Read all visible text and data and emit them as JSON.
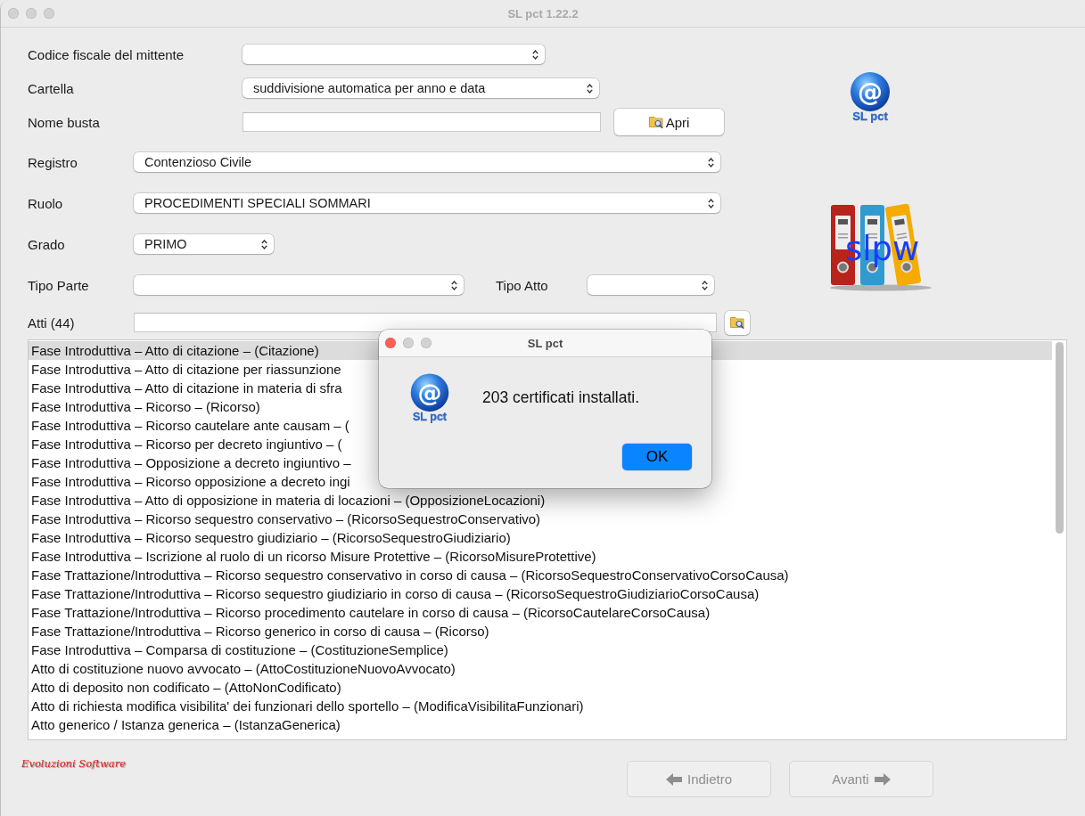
{
  "window": {
    "title": "SL pct 1.22.2",
    "focused": false
  },
  "envelope_fields": [
    {
      "kind": "select",
      "label": "Codice fiscale del mittente"
    },
    {
      "kind": "select",
      "label": "Cartella",
      "value": "suddivisione automatica per anno e data"
    },
    {
      "kind": "text",
      "label": "Nome busta",
      "button": "Apri"
    }
  ],
  "case_fields": [
    {
      "kind": "select",
      "label": "Registro",
      "value": "Contenzioso Civile"
    },
    {
      "kind": "select",
      "label": "Ruolo",
      "value": "PROCEDIMENTI SPECIALI SOMMARI"
    },
    {
      "kind": "select",
      "label": "Grado",
      "value": "PRIMO"
    },
    {
      "kind": "pair",
      "label": "Tipo Parte",
      "second_label": "Tipo Atto"
    },
    {
      "kind": "search",
      "label": "Atti (44)"
    }
  ],
  "logo": {
    "symbol": "@",
    "caption": "SL pct"
  },
  "binders_logo": {
    "text": "slpw"
  },
  "acts_list": {
    "rows": [
      {
        "text": "Fase Introduttiva – Atto di citazione – (Citazione)",
        "selected": true
      },
      {
        "text": "Fase Introduttiva – Atto di citazione per riassunzione",
        "selected": false
      },
      {
        "text": "Fase Introduttiva – Atto di citazione in materia di sfra",
        "selected": false
      },
      {
        "text": "Fase Introduttiva – Ricorso – (Ricorso)",
        "selected": false
      },
      {
        "text": "Fase Introduttiva – Ricorso cautelare ante causam – (",
        "selected": false
      },
      {
        "text": "Fase Introduttiva – Ricorso per decreto ingiuntivo – (",
        "selected": false
      },
      {
        "text": "Fase Introduttiva – Opposizione a decreto ingiuntivo –",
        "selected": false
      },
      {
        "text": "Fase Introduttiva – Ricorso opposizione a decreto ingi",
        "selected": false
      },
      {
        "text": "Fase Introduttiva – Atto di opposizione in materia di locazioni – (OpposizioneLocazioni)",
        "selected": false
      },
      {
        "text": "Fase Introduttiva – Ricorso sequestro conservativo – (RicorsoSequestroConservativo)",
        "selected": false
      },
      {
        "text": "Fase Introduttiva – Ricorso sequestro giudiziario – (RicorsoSequestroGiudiziario)",
        "selected": false
      },
      {
        "text": "Fase Introduttiva – Iscrizione al ruolo di un ricorso Misure Protettive – (RicorsoMisureProtettive)",
        "selected": false
      },
      {
        "text": "Fase Trattazione/Introduttiva – Ricorso sequestro conservativo in corso di causa – (RicorsoSequestroConservativoCorsoCausa)",
        "selected": false
      },
      {
        "text": "Fase Trattazione/Introduttiva – Ricorso sequestro giudiziario in corso di causa – (RicorsoSequestroGiudiziarioCorsoCausa)",
        "selected": false
      },
      {
        "text": "Fase Trattazione/Introduttiva – Ricorso procedimento cautelare in corso di causa – (RicorsoCautelareCorsoCausa)",
        "selected": false
      },
      {
        "text": "Fase Trattazione/Introduttiva – Ricorso generico in corso di causa – (Ricorso)",
        "selected": false
      },
      {
        "text": "Fase Introduttiva – Comparsa di costituzione – (CostituzioneSemplice)",
        "selected": false
      },
      {
        "text": "Atto di costituzione nuovo avvocato – (AttoCostituzioneNuovoAvvocato)",
        "selected": false
      },
      {
        "text": "Atto di deposito non codificato – (AttoNonCodificato)",
        "selected": false
      },
      {
        "text": "Atto di richiesta modifica visibilita' dei funzionari dello sportello – (ModificaVisibilitaFunzionari)",
        "selected": false
      },
      {
        "text": "Atto generico / Istanza generica – (IstanzaGenerica)",
        "selected": false
      }
    ]
  },
  "footer": {
    "signature": "Evoluzioni Software",
    "buttons": [
      {
        "kind": "back",
        "label": "Indietro",
        "disabled": true
      },
      {
        "kind": "next",
        "label": "Avanti",
        "disabled": true
      }
    ]
  },
  "dialog": {
    "title": "SL pct",
    "focused": true,
    "logo": {
      "symbol": "@",
      "caption": "SL pct"
    },
    "message": "203 certificati installati.",
    "button": "OK"
  }
}
